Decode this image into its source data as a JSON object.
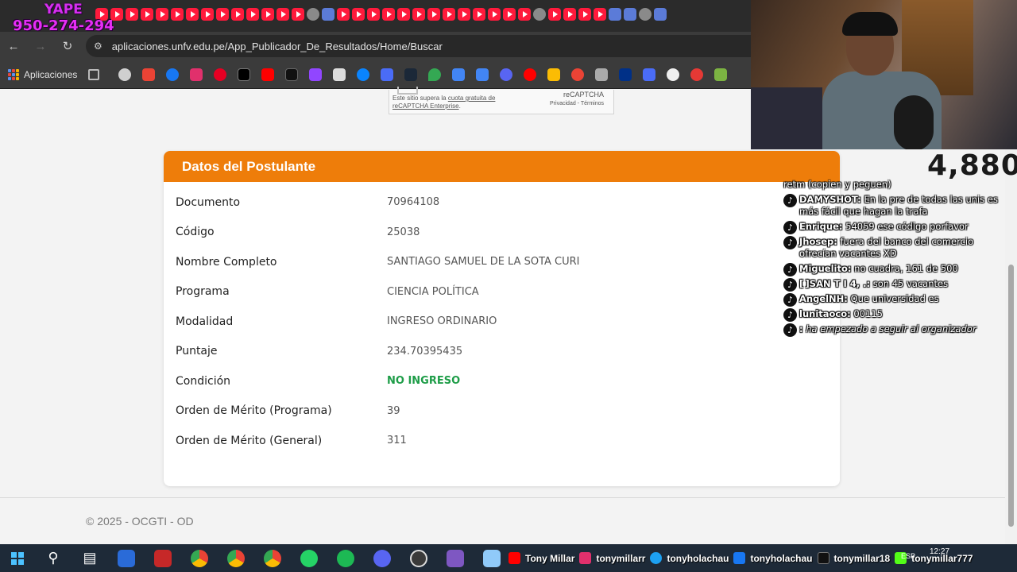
{
  "browser": {
    "url": "aplicaciones.unfv.edu.pe/App_Publicador_De_Resultados/Home/Buscar",
    "bookmarks_apps_label": "Aplicaciones"
  },
  "overlay": {
    "yape_title": "YAPE",
    "yape_number": "950-274-294",
    "viewer_count": "4,880"
  },
  "recaptcha": {
    "note_prefix": "Este sitio supera la ",
    "note_link": "cuota gratuita de reCAPTCHA Enterprise",
    "note_suffix": ".",
    "brand": "reCAPTCHA",
    "terms": "Privacidad - Términos"
  },
  "card": {
    "title": "Datos del Postulante",
    "rows": [
      {
        "label": "Documento",
        "value": "70964108"
      },
      {
        "label": "Código",
        "value": "25038"
      },
      {
        "label": "Nombre Completo",
        "value": "SANTIAGO SAMUEL DE LA SOTA CURI"
      },
      {
        "label": "Programa",
        "value": "CIENCIA POLÍTICA"
      },
      {
        "label": "Modalidad",
        "value": "INGRESO ORDINARIO"
      },
      {
        "label": "Puntaje",
        "value": "234.70395435"
      },
      {
        "label": "Condición",
        "value": "NO INGRESO"
      },
      {
        "label": "Orden de Mérito (Programa)",
        "value": "39"
      },
      {
        "label": "Orden de Mérito (General)",
        "value": "311"
      }
    ]
  },
  "footer": {
    "copyright": "© 2025 - OCGTI - OD"
  },
  "chat": [
    {
      "user": "",
      "text": "retm (copien y peguen)",
      "icon": false
    },
    {
      "user": "DAMYSHOT:",
      "text": " En la pre de todas las unis es más fácil que hagan la trafa",
      "icon": true
    },
    {
      "user": "Enrique:",
      "text": " 54059 ese código porfavor",
      "icon": true
    },
    {
      "user": "Jhosep:",
      "text": " fuera del banco del comercio ofrecían vacantes XD",
      "icon": true
    },
    {
      "user": "Miguelito:",
      "text": " no cuadra, 161 de 500",
      "icon": true
    },
    {
      "user": "[ ]SAN T I 4, .:",
      "text": " son 45 vacantes",
      "icon": true
    },
    {
      "user": "AngelNH:",
      "text": " Que universidad es",
      "icon": true
    },
    {
      "user": "lunitaoco:",
      "text": " 00115",
      "icon": true
    },
    {
      "user": ":",
      "text": " ha empezado a seguir al organizador",
      "icon": true,
      "follow": true
    }
  ],
  "taskbar": {
    "socials": [
      "Tony Millar",
      "tonymillarr",
      "tonyholachau",
      "tonyholachau",
      "tonymillar18",
      "tonymillar777"
    ],
    "lang": "ESP",
    "time": "12:27"
  },
  "colors": {
    "header_orange": "#ee7d0a",
    "status_green": "#1e9d48"
  }
}
